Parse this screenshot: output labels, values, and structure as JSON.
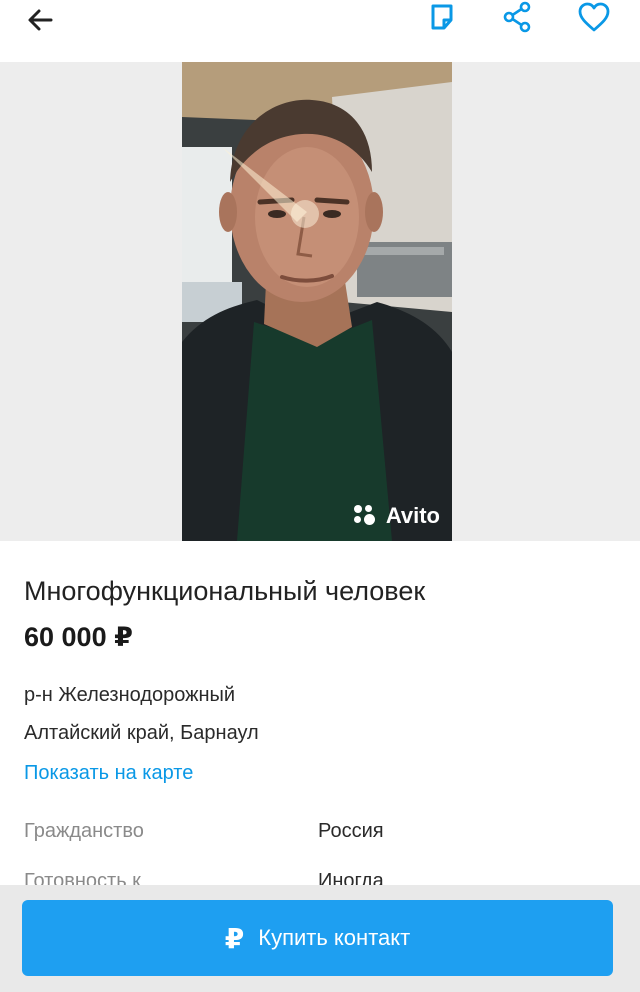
{
  "toolbar": {
    "back_icon": "arrow-left-icon",
    "actions": [
      "note-icon",
      "share-icon",
      "heart-icon"
    ],
    "icon_color": "#0a98e6"
  },
  "gallery": {
    "watermark": "Avito"
  },
  "listing": {
    "title": "Многофункциональный человек",
    "price": "60 000 ₽",
    "district": "р-н Железнодорожный",
    "region_city": "Алтайский край, Барнаул",
    "map_link": "Показать на карте"
  },
  "params": [
    {
      "key": "Гражданство",
      "value": "Россия"
    },
    {
      "key": "Готовность к",
      "value": "Иногда"
    }
  ],
  "cta": {
    "icon": "₽",
    "label": "Купить контакт",
    "color": "#1e9ff1"
  }
}
